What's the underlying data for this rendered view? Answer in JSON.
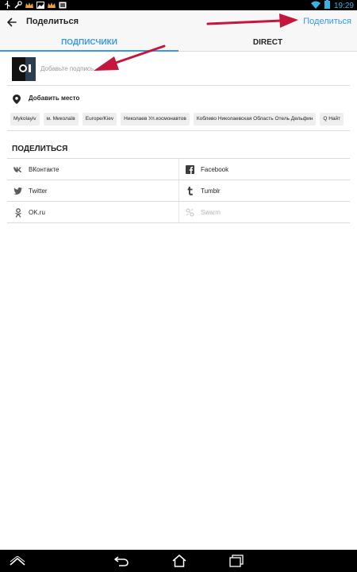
{
  "status_bar": {
    "time": "19:29",
    "icons": [
      "usb-icon",
      "wrench-icon",
      "crown-icon",
      "image-icon",
      "crown-icon",
      "gallery-icon"
    ],
    "right_icons": [
      "wifi-icon",
      "battery-icon"
    ]
  },
  "appbar": {
    "title": "Поделиться",
    "action": "Поделиться"
  },
  "tabs": [
    {
      "label": "ПОДПИСЧИКИ",
      "active": true
    },
    {
      "label": "DIRECT",
      "active": false
    }
  ],
  "caption": {
    "placeholder": "Добавьте подпись..."
  },
  "place": {
    "label": "Добавить место"
  },
  "place_suggestions": [
    "Mykolayiv",
    "м. Миколаїв",
    "Europe/Kiev",
    "Николаев Ул.космонавтов",
    "Коблево Николаевская Область Отель Дельфин",
    "Q Найт"
  ],
  "share": {
    "title": "ПОДЕЛИТЬСЯ",
    "targets": [
      {
        "label": "ВКонтакте",
        "icon": "vk-icon",
        "enabled": true
      },
      {
        "label": "Facebook",
        "icon": "facebook-icon",
        "enabled": true
      },
      {
        "label": "Twitter",
        "icon": "twitter-icon",
        "enabled": true
      },
      {
        "label": "Tumblr",
        "icon": "tumblr-icon",
        "enabled": true
      },
      {
        "label": "OK.ru",
        "icon": "ok-icon",
        "enabled": true
      },
      {
        "label": "Swarm",
        "icon": "swarm-icon",
        "enabled": false
      }
    ]
  },
  "navbar": {
    "icons": [
      "home-up-icon",
      "back-icon",
      "home-icon",
      "recent-apps-icon"
    ]
  },
  "colors": {
    "accent": "#3897f0",
    "annotation_arrow": "#c4173d"
  }
}
